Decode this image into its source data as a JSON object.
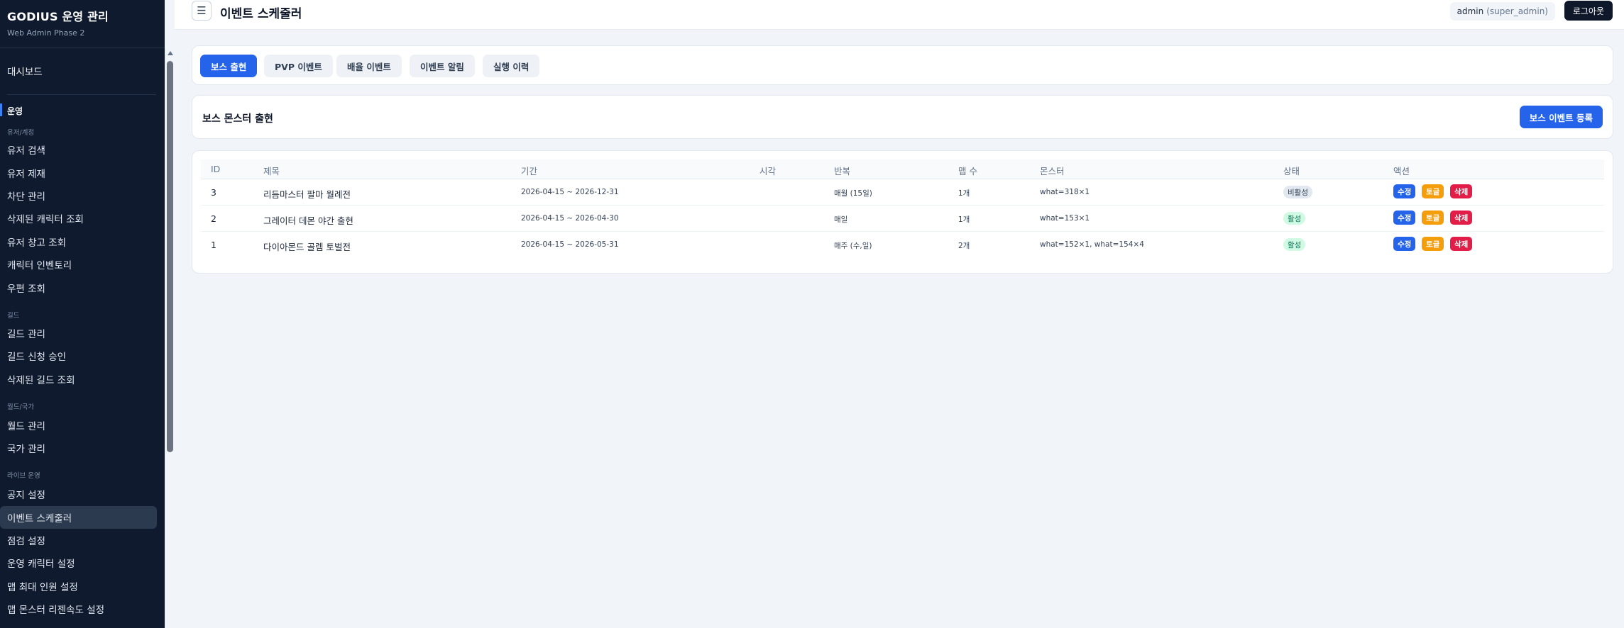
{
  "sidebar": {
    "title": "GODIUS 운영 관리",
    "subtitle": "Web Admin Phase 2",
    "dashboard": "대시보드",
    "section": "운영",
    "groups": [
      {
        "category": "유저/계정",
        "items": [
          "유저 검색",
          "유저 제재",
          "차단 관리",
          "삭제된 캐릭터 조회",
          "유저 창고 조회",
          "캐릭터 인벤토리",
          "우편 조회"
        ]
      },
      {
        "category": "길드",
        "items": [
          "길드 관리",
          "길드 신청 승인",
          "삭제된 길드 조회"
        ]
      },
      {
        "category": "월드/국가",
        "items": [
          "월드 관리",
          "국가 관리"
        ]
      },
      {
        "category": "라이브 운영",
        "items": [
          "공지 설정",
          "이벤트 스케줄러",
          "점검 설정",
          "운영 캐릭터 설정",
          "맵 최대 인원 설정",
          "맵 몬스터 리젠속도 설정"
        ]
      }
    ],
    "active_item": "이벤트 스케줄러"
  },
  "header": {
    "menu_icon": "hamburger-icon",
    "title": "이벤트 스케줄러",
    "user": "admin",
    "role": "(super_admin)",
    "logout": "로그아웃"
  },
  "tabs": [
    {
      "label": "보스 출현",
      "active": true
    },
    {
      "label": "PVP 이벤트",
      "active": false
    },
    {
      "label": "배율 이벤트",
      "active": false
    },
    {
      "label": "이벤트 알림",
      "active": false
    },
    {
      "label": "실행 이력",
      "active": false
    }
  ],
  "section": {
    "title": "보스 몬스터 출현",
    "add_button": "보스 이벤트 등록"
  },
  "table": {
    "columns": [
      "ID",
      "제목",
      "기간",
      "시각",
      "반복",
      "맵 수",
      "몬스터",
      "상태",
      "액션"
    ],
    "rows": [
      {
        "id": "3",
        "title": "리듬마스터 팔마 월례전",
        "period": "2026-04-15 ~ 2026-12-31",
        "time": "",
        "repeat": "매월 (15일)",
        "maps": "1개",
        "monsters": "what=318×1",
        "status": "비활성",
        "status_active": false
      },
      {
        "id": "2",
        "title": "그레이터 데몬 야간 출현",
        "period": "2026-04-15 ~ 2026-04-30",
        "time": "",
        "repeat": "매일",
        "maps": "1개",
        "monsters": "what=153×1",
        "status": "활성",
        "status_active": true
      },
      {
        "id": "1",
        "title": "다이아몬드 골렘 토벌전",
        "period": "2026-04-15 ~ 2026-05-31",
        "time": "",
        "repeat": "매주 (수,일)",
        "maps": "2개",
        "monsters": "what=152×1, what=154×4",
        "status": "활성",
        "status_active": true
      }
    ],
    "actions": {
      "edit": "수정",
      "toggle": "토글",
      "delete": "삭제"
    }
  },
  "colors": {
    "sidebar_bg": "#0f1a2e",
    "primary": "#2563eb",
    "toggle": "#f59e0b",
    "delete": "#e11d48",
    "active_badge": "#d1fae5"
  }
}
